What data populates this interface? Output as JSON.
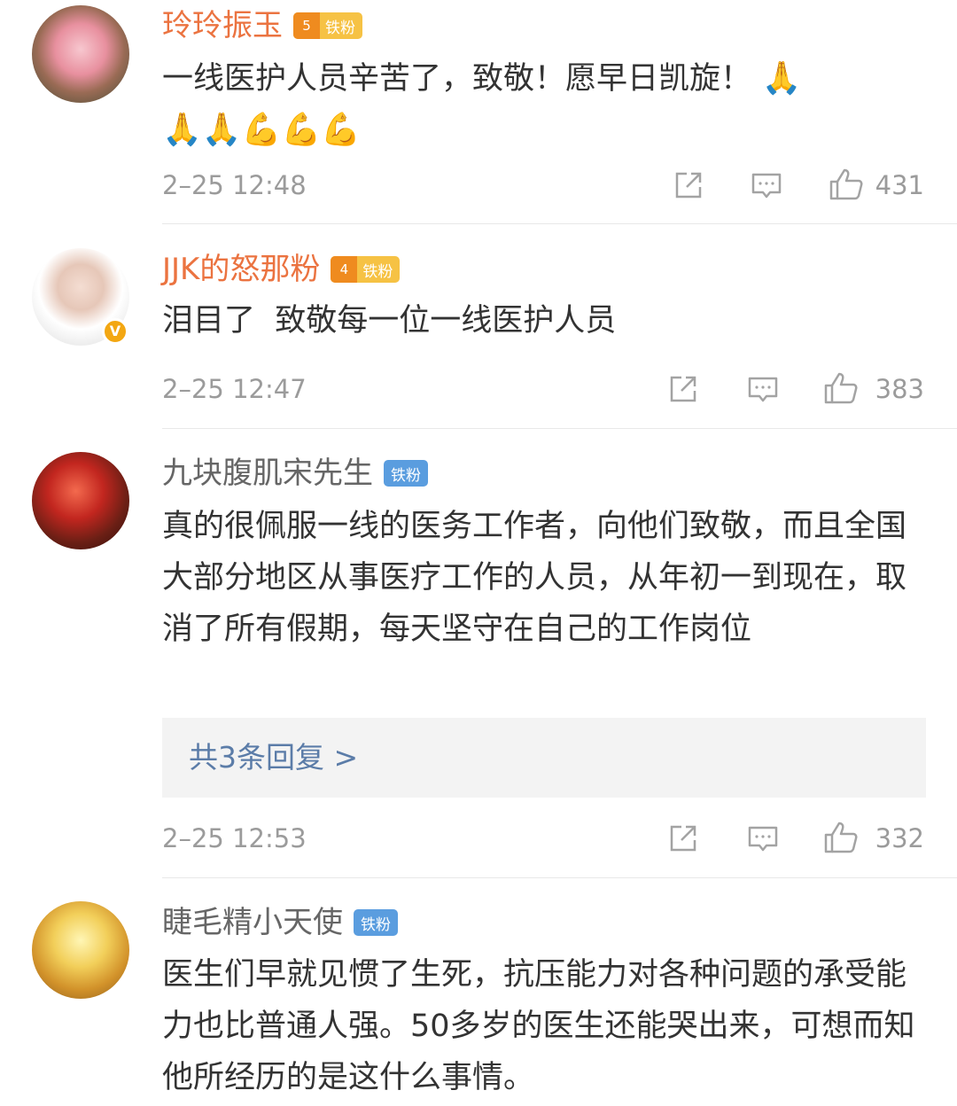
{
  "comments": [
    {
      "username": "玲玲振玉",
      "fan_badge": "铁粉",
      "fan_level": "5",
      "text": "一线医护人员辛苦了，致敬！愿早日凯旋！",
      "emojis": [
        "pray-emoji",
        "pray-emoji",
        "pray-emoji",
        "muscle-emoji",
        "muscle-emoji",
        "muscle-emoji"
      ],
      "time": "2–25 12:48",
      "likes": "431"
    },
    {
      "username": "JJK的怒那粉",
      "fan_badge": "铁粉",
      "fan_level": "4",
      "verified": "V",
      "text": "泪目了  致敬每一位一线医护人员",
      "time": "2–25 12:47",
      "likes": "383"
    },
    {
      "username": "九块腹肌宋先生",
      "fan_badge": "铁粉",
      "text": "真的很佩服一线的医务工作者，向他们致敬，而且全国大部分地区从事医疗工作的人员，从年初一到现在，取消了所有假期，每天坚守在自己的工作岗位",
      "replies_label": "共3条回复 >",
      "time": "2–25 12:53",
      "likes": "332"
    },
    {
      "username": "睫毛精小天使",
      "fan_badge": "铁粉",
      "text": "医生们早就见惯了生死，抗压能力对各种问题的承受能力也比普通人强。50多岁的医生还能哭出来，可想而知他所经历的是这什么事情。"
    }
  ],
  "colors": {
    "username_vip": "#eb7340",
    "username_normal": "#666666",
    "link": "#5b7ca8",
    "meta_gray": "#9b9b9b"
  },
  "icons": [
    "share-icon",
    "comment-icon",
    "like-icon"
  ]
}
